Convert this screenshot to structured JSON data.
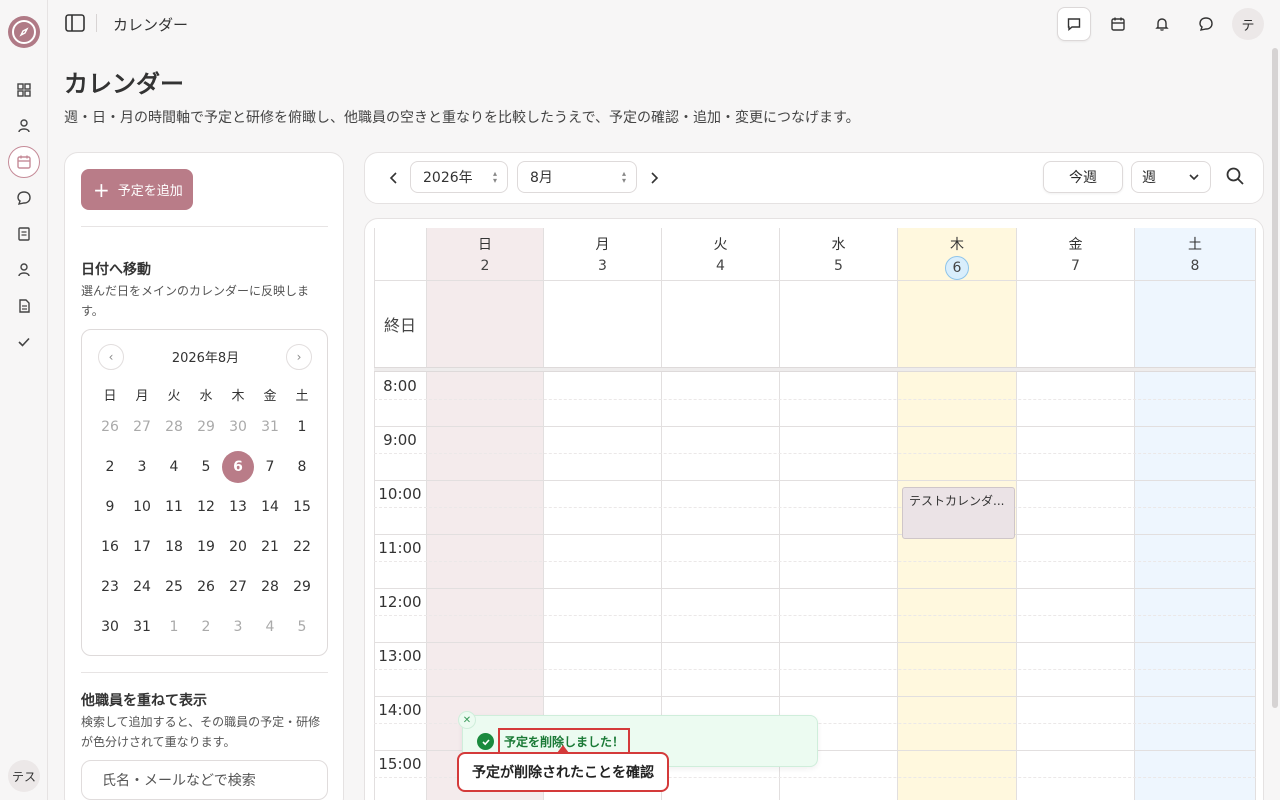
{
  "app": {
    "user_initial": "テ",
    "rail_user": "テス"
  },
  "topbar": {
    "breadcrumb": "カレンダー"
  },
  "page": {
    "title": "カレンダー",
    "description": "週・日・月の時間軸で予定と研修を俯瞰し、他職員の空きと重なりを比較したうえで、予定の確認・追加・変更につなげます。"
  },
  "left_panel": {
    "add_button": "予定を追加",
    "goto_title": "日付へ移動",
    "goto_desc": "選んだ日をメインのカレンダーに反映します。",
    "mini_cal": {
      "title": "2026年8月",
      "weekdays": [
        "日",
        "月",
        "火",
        "水",
        "木",
        "金",
        "土"
      ],
      "weeks": [
        [
          "26",
          "27",
          "28",
          "29",
          "30",
          "31",
          "1"
        ],
        [
          "2",
          "3",
          "4",
          "5",
          "6",
          "7",
          "8"
        ],
        [
          "9",
          "10",
          "11",
          "12",
          "13",
          "14",
          "15"
        ],
        [
          "16",
          "17",
          "18",
          "19",
          "20",
          "21",
          "22"
        ],
        [
          "23",
          "24",
          "25",
          "26",
          "27",
          "28",
          "29"
        ],
        [
          "30",
          "31",
          "1",
          "2",
          "3",
          "4",
          "5"
        ]
      ],
      "selected": "6"
    },
    "overlay_title": "他職員を重ねて表示",
    "overlay_desc": "検索して追加すると、その職員の予定・研修が色分けされて重なります。",
    "search_placeholder": "氏名・メールなどで検索"
  },
  "toolbar": {
    "year": "2026年",
    "month": "8月",
    "today_button": "今週",
    "view": "週"
  },
  "calendar": {
    "days": [
      {
        "name": "日",
        "date": "2"
      },
      {
        "name": "月",
        "date": "3"
      },
      {
        "name": "火",
        "date": "4"
      },
      {
        "name": "水",
        "date": "5"
      },
      {
        "name": "木",
        "date": "6"
      },
      {
        "name": "金",
        "date": "7"
      },
      {
        "name": "土",
        "date": "8"
      }
    ],
    "all_day_label": "終日",
    "times": [
      "8:00",
      "9:00",
      "10:00",
      "11:00",
      "12:00",
      "13:00",
      "14:00",
      "15:00"
    ],
    "event": {
      "title": "テストカレンダ..."
    }
  },
  "toast": {
    "message": "予定を削除しました！",
    "callout": "予定が削除されたことを確認"
  },
  "colors": {
    "accent": "#b97c88",
    "sunday_bg": "#f4ebec",
    "today_bg": "#fff8de",
    "saturday_bg": "#eef6fe",
    "toast_bg": "#ecfbf1",
    "highlight": "#d43a3a"
  }
}
